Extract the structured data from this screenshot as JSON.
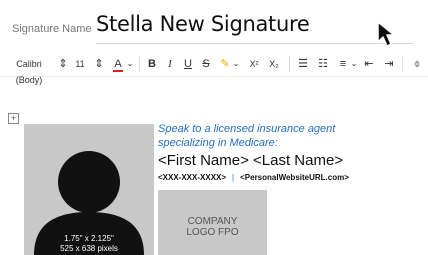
{
  "signature": {
    "name_label": "Signature Name",
    "name_value": "Stella New Signature"
  },
  "toolbar": {
    "font_family": "Calibri (Body)",
    "font_size": "11",
    "bold": "B",
    "italic": "I",
    "underline": "U",
    "strikethrough": "S",
    "superscript": "X²",
    "subscript": "X₂"
  },
  "body": {
    "tagline_line1": "Speak to a licensed insurance agent",
    "tagline_line2": "specializing in Medicare:",
    "full_name": "<First Name> <Last Name>",
    "phone": "<XXX-XXX-XXXX>",
    "separator": "|",
    "website": "<PersonalWebsiteURL.com>",
    "photo_dimensions": "1.75\" x 2.125\"",
    "photo_pixels": "525 x 638 pixels",
    "logo_line1": "COMPANY",
    "logo_line2": "LOGO FPO",
    "expand_symbol": "+"
  },
  "colors": {
    "accent": "#1f6fc4",
    "placeholder_gray": "#c8c8c8"
  }
}
